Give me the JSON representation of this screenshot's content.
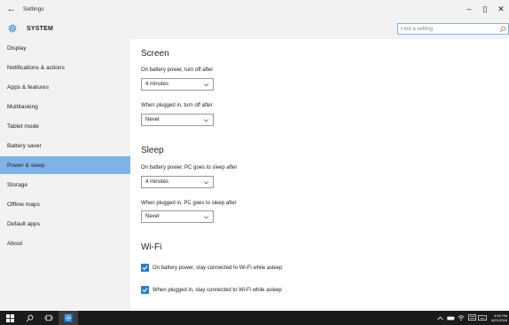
{
  "window": {
    "back_glyph": "←",
    "title": "Settings",
    "minimize_glyph": "–",
    "maximize_glyph": "▯",
    "close_glyph": "✕"
  },
  "header": {
    "title": "SYSTEM",
    "search_placeholder": "Find a setting"
  },
  "sidebar": {
    "items": [
      {
        "label": "Display"
      },
      {
        "label": "Notifications & actions"
      },
      {
        "label": "Apps & features"
      },
      {
        "label": "Multitasking"
      },
      {
        "label": "Tablet mode"
      },
      {
        "label": "Battery saver"
      },
      {
        "label": "Power & sleep",
        "selected": true
      },
      {
        "label": "Storage"
      },
      {
        "label": "Offline maps"
      },
      {
        "label": "Default apps"
      },
      {
        "label": "About"
      }
    ]
  },
  "screen": {
    "heading": "Screen",
    "battery_label": "On battery power, turn off after",
    "battery_value": "4 minutes",
    "plugged_label": "When plugged in, turn off after",
    "plugged_value": "Never"
  },
  "sleep": {
    "heading": "Sleep",
    "battery_label": "On battery power, PC goes to sleep after",
    "battery_value": "4 minutes",
    "plugged_label": "When plugged in, PC goes to sleep after",
    "plugged_value": "Never"
  },
  "wifi": {
    "heading": "Wi-Fi",
    "battery_check_label": "On battery power, stay connected to Wi-Fi while asleep",
    "battery_checked": true,
    "plugged_check_label": "When plugged in, stay connected to Wi-Fi while asleep",
    "plugged_checked": true
  },
  "taskbar": {
    "time": "4:50 PM",
    "date": "6/21/2016"
  },
  "colors": {
    "accent": "#2a7fd4",
    "selected_item": "#7fb2e5",
    "sidebar_bg": "#f2f2f2",
    "taskbar_bg": "#1b1b1b"
  }
}
